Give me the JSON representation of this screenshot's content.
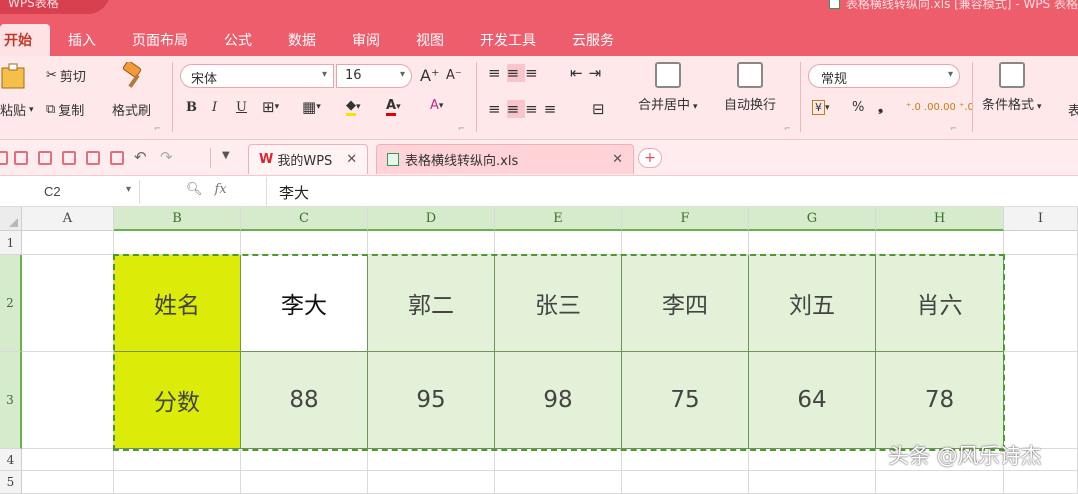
{
  "window": {
    "app_name": "WPS表格",
    "doc_title": "表格横线转纵向.xls [兼容模式] - WPS 表格"
  },
  "ribbon_tabs": [
    "开始",
    "插入",
    "页面布局",
    "公式",
    "数据",
    "审阅",
    "视图",
    "开发工具",
    "云服务"
  ],
  "ribbon": {
    "clipboard": {
      "paste": "粘贴",
      "cut": "剪切",
      "copy": "复制",
      "format_painter": "格式刷"
    },
    "font": {
      "name": "宋体",
      "size": "16",
      "bold": "B",
      "italic": "I",
      "underline": "U",
      "grow": "A⁺",
      "shrink": "A⁻"
    },
    "alignment": {
      "merge_center": "合并居中",
      "wrap_text": "自动换行"
    },
    "number": {
      "format": "常规",
      "percent": "%",
      "comma": "❟",
      "inc_decimal": "⁺.0 .00",
      "dec_decimal": ".00 ⁺.0"
    },
    "styles": {
      "conditional_format": "条件格式",
      "cut_off_label": "表"
    }
  },
  "doc_tabs": [
    {
      "label": "我的WPS",
      "logo": "W"
    },
    {
      "label": "表格横线转纵向.xls"
    }
  ],
  "formula_bar": {
    "cell_ref": "C2",
    "fx": "fx",
    "value": "李大"
  },
  "sheet": {
    "columns": [
      "A",
      "B",
      "C",
      "D",
      "E",
      "F",
      "G",
      "H",
      "I"
    ],
    "rows": [
      "1",
      "2",
      "3",
      "4",
      "5"
    ],
    "row2": [
      "姓名",
      "李大",
      "郭二",
      "张三",
      "李四",
      "刘五",
      "肖六"
    ],
    "row3": [
      "分数",
      "88",
      "95",
      "98",
      "75",
      "64",
      "78"
    ],
    "active_cell": "C2",
    "selected_range": "B2:H3",
    "colors": {
      "label_fill": "#dcec08",
      "selection_fill": "#e2f1d8",
      "marquee": "#4a9a2e",
      "accent": "#ee5d6b"
    }
  },
  "watermark": "头条 @风乐诗杰"
}
